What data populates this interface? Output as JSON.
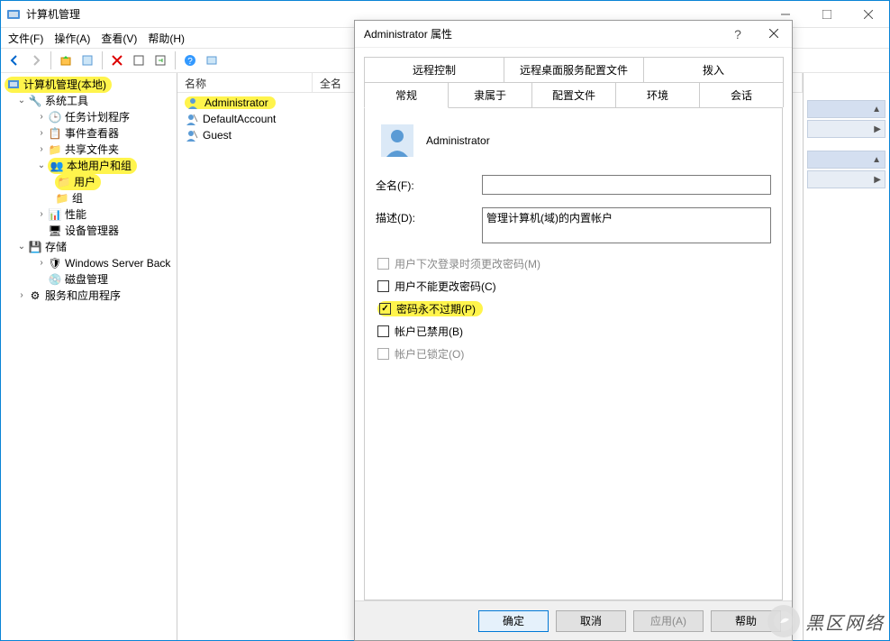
{
  "window": {
    "title": "计算机管理"
  },
  "menu": {
    "file": "文件(F)",
    "action": "操作(A)",
    "view": "查看(V)",
    "help": "帮助(H)"
  },
  "tree": {
    "root": "计算机管理(本地)",
    "sys_tools": "系统工具",
    "task_sched": "任务计划程序",
    "event_viewer": "事件查看器",
    "shared_folders": "共享文件夹",
    "local_users_groups": "本地用户和组",
    "users": "用户",
    "groups": "组",
    "performance": "性能",
    "device_mgr": "设备管理器",
    "storage": "存储",
    "wsb": "Windows Server Back",
    "disk_mgmt": "磁盘管理",
    "services_apps": "服务和应用程序"
  },
  "list": {
    "col_name": "名称",
    "col_fullname": "全名",
    "rows": [
      "Administrator",
      "DefaultAccount",
      "Guest"
    ]
  },
  "dialog": {
    "title": "Administrator 属性",
    "tabs_row1": [
      "远程控制",
      "远程桌面服务配置文件",
      "拨入"
    ],
    "tabs_row2": [
      "常规",
      "隶属于",
      "配置文件",
      "环境",
      "会话"
    ],
    "username": "Administrator",
    "fullname_label": "全名(F):",
    "fullname_value": "",
    "desc_label": "描述(D):",
    "desc_value": "管理计算机(域)的内置帐户",
    "chk_must_change": "用户下次登录时须更改密码(M)",
    "chk_cannot_change": "用户不能更改密码(C)",
    "chk_never_expire": "密码永不过期(P)",
    "chk_disabled": "帐户已禁用(B)",
    "chk_locked": "帐户已锁定(O)",
    "btn_ok": "确定",
    "btn_cancel": "取消",
    "btn_apply": "应用(A)",
    "btn_help": "帮助"
  },
  "watermark": "黑区网络"
}
